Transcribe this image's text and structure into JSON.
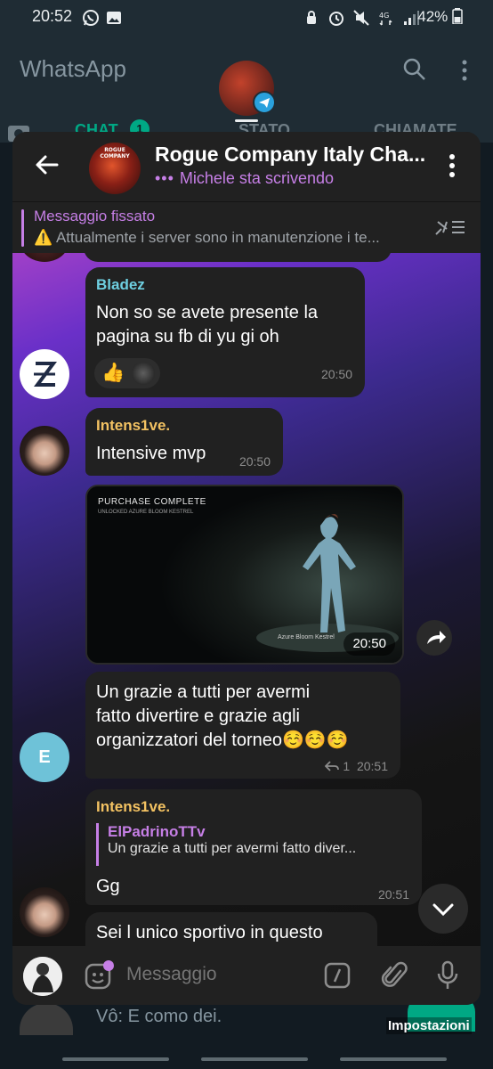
{
  "status_bar": {
    "time": "20:52",
    "battery": "42%",
    "network": "4G"
  },
  "whatsapp": {
    "title": "WhatsApp",
    "tabs": {
      "chat": "CHAT",
      "chat_count": "1",
      "stato": "STATO",
      "chiamate": "CHIAMATE"
    },
    "bottom_chat_preview": "Vô: E como dei.",
    "impostazioni": "Impostazioni",
    "accent": "#00a884"
  },
  "telegram": {
    "header": {
      "title": "Rogue Company Italy Cha...",
      "typing_dots": "•••",
      "typing": "Michele sta scrivendo",
      "avatar_text": "ROGUE COMPANY"
    },
    "pinned": {
      "title": "Messaggio fissato",
      "text": "⚠️ Attualmente i server sono in manutenzione i te..."
    },
    "messages": {
      "m1": {
        "sender": "Bladez",
        "text_line1": "Non so se avete presente la",
        "text_line2": "pagina su fb di yu gi oh",
        "reaction": "👍",
        "time": "20:50",
        "sender_color": "#6ecfe0"
      },
      "m2": {
        "sender": "Intens1ve.",
        "text": "Intensive mvp",
        "time": "20:50",
        "sender_color": "#f3c262"
      },
      "m3": {
        "media_title": "PURCHASE COMPLETE",
        "media_sub": "UNLOCKED AZURE BLOOM KESTREL",
        "media_caption": "Azure Bloom Kestrel",
        "time": "20:50"
      },
      "m4": {
        "avatar_letter": "E",
        "text_line1": "Un grazie a tutti per avermi",
        "text_line2": "fatto divertire e grazie agli",
        "text_line3": "organizzatori del torneo☺️☺️☺️",
        "replies": "1",
        "time": "20:51"
      },
      "m5": {
        "sender": "Intens1ve.",
        "reply_name": "ElPadrinoTTv",
        "reply_text": "Un grazie a tutti per avermi fatto diver...",
        "text": "Gg",
        "time": "20:51",
        "sender_color": "#f3c262"
      },
      "m6": {
        "text": "Sei l unico sportivo in questo"
      }
    },
    "input": {
      "placeholder": "Messaggio"
    },
    "accent": "#c67fe6"
  }
}
